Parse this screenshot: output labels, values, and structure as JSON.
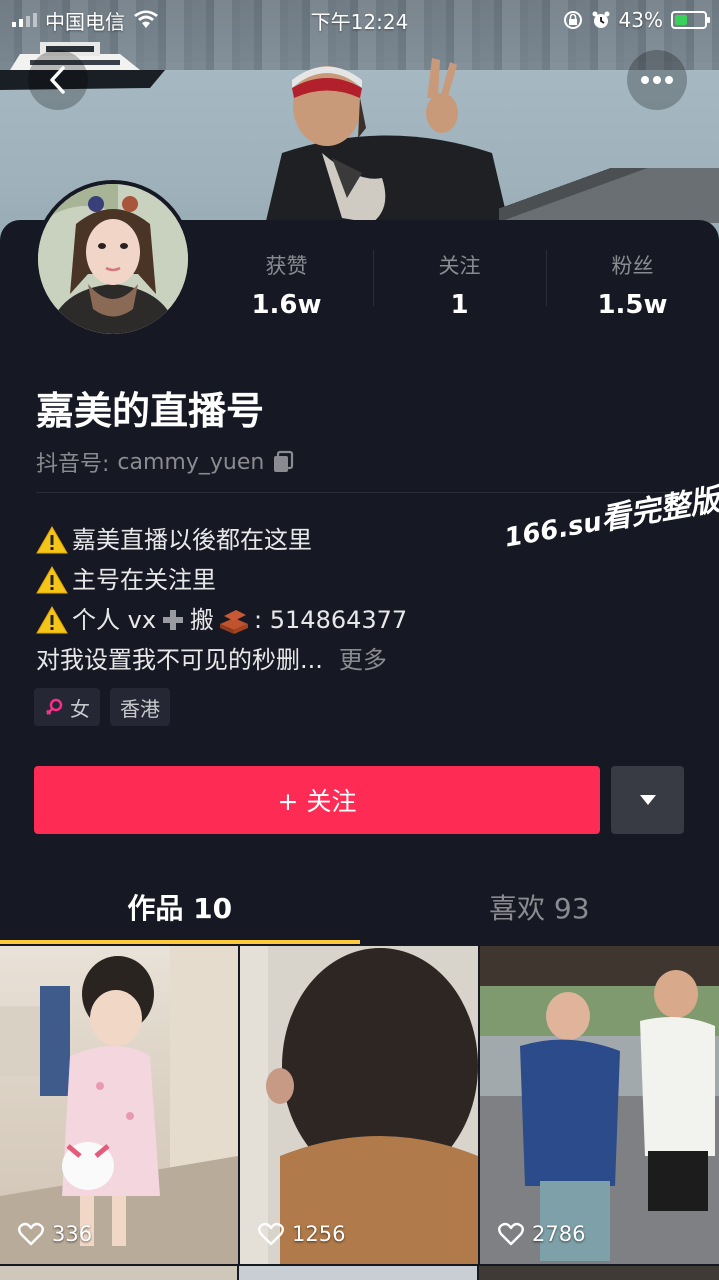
{
  "status_bar": {
    "carrier": "中国电信",
    "time": "下午12:24",
    "battery": "43%",
    "battery_level": 0.43
  },
  "header": {
    "back_icon": "chevron-left-icon",
    "more_icon": "ellipsis-icon"
  },
  "stats": [
    {
      "label": "获赞",
      "value": "1.6w"
    },
    {
      "label": "关注",
      "value": "1"
    },
    {
      "label": "粉丝",
      "value": "1.5w"
    }
  ],
  "profile": {
    "name": "嘉美的直播号",
    "douyin_id_label": "抖音号:",
    "douyin_id": "cammy_yuen"
  },
  "bio": {
    "line1": "嘉美直播以後都在这里",
    "line2": "主号在关注里",
    "line3_a": "个人 vx",
    "line3_b": "搬",
    "line3_c": ":  514864377",
    "line4": "对我设置我不可见的秒删...",
    "more": "更多"
  },
  "watermark": {
    "a": "166.su",
    "b": "看完整版"
  },
  "tags": [
    {
      "label": "女",
      "icon": "female-icon"
    },
    {
      "label": "香港"
    }
  ],
  "actions": {
    "follow": "+ 关注",
    "dropdown_icon": "caret-down-icon"
  },
  "tabs": [
    {
      "label": "作品 10",
      "active": true
    },
    {
      "label": "喜欢 93",
      "active": false
    }
  ],
  "videos": [
    {
      "likes": "336"
    },
    {
      "likes": "1256"
    },
    {
      "likes": "2786"
    }
  ],
  "colors": {
    "background": "#161823",
    "follow_button": "#fe2c55",
    "tab_indicator": "#fcca3c",
    "secondary_text": "#8a8b91"
  }
}
